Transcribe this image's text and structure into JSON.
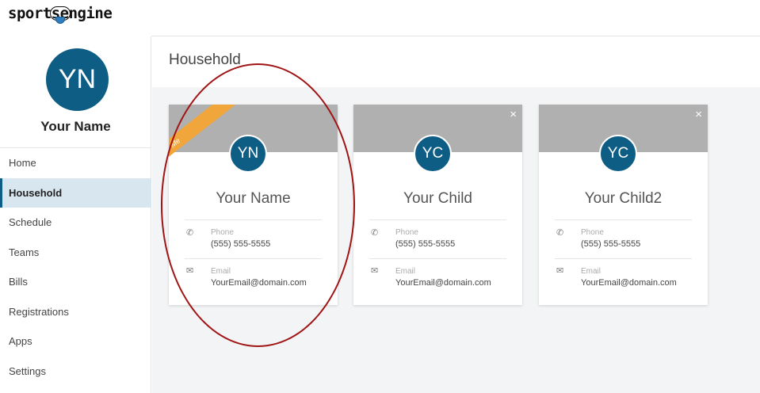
{
  "brand": {
    "logo_left": "sport",
    "logo_mid": "se",
    "logo_right": "ngine"
  },
  "profile": {
    "initials": "YN",
    "name": "Your Name"
  },
  "nav": [
    {
      "label": "Home",
      "active": false
    },
    {
      "label": "Household",
      "active": true
    },
    {
      "label": "Schedule",
      "active": false
    },
    {
      "label": "Teams",
      "active": false
    },
    {
      "label": "Bills",
      "active": false
    },
    {
      "label": "Registrations",
      "active": false
    },
    {
      "label": "Apps",
      "active": false
    },
    {
      "label": "Settings",
      "active": false
    }
  ],
  "page": {
    "title": "Household"
  },
  "members": [
    {
      "initials": "YN",
      "name": "Your Name",
      "badge": "Me",
      "phone_label": "Phone",
      "phone": "(555) 555-5555",
      "email_label": "Email",
      "email": "YourEmail@domain.com"
    },
    {
      "initials": "YC",
      "name": "Your Child",
      "close": "×",
      "phone_label": "Phone",
      "phone": "(555) 555-5555",
      "email_label": "Email",
      "email": "YourEmail@domain.com"
    },
    {
      "initials": "YC",
      "name": "Your Child2",
      "close": "×",
      "phone_label": "Phone",
      "phone": "(555) 555-5555",
      "email_label": "Email",
      "email": "YourEmail@domain.com"
    }
  ],
  "colors": {
    "accent": "#0e5d85",
    "badge": "#f0a63a",
    "annotation": "#a01414"
  }
}
